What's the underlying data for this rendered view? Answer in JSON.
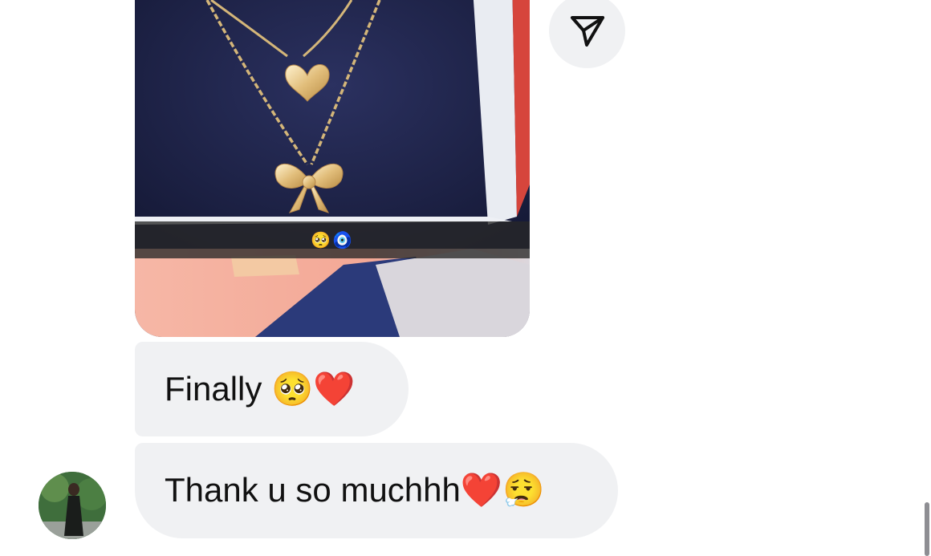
{
  "shared_post": {
    "caption": "🥺🧿"
  },
  "share_button": {
    "icon": "paper-plane-icon"
  },
  "messages": [
    {
      "text": "Finally 🥺❤️"
    },
    {
      "text": "Thank u so muchhh❤️😮‍💨"
    }
  ],
  "sender": {
    "avatar_icon": "user-avatar"
  },
  "colors": {
    "bubble": "#f0f1f3",
    "text": "#111111",
    "velvet": "#1f2447",
    "gold": "#d9b26a"
  }
}
